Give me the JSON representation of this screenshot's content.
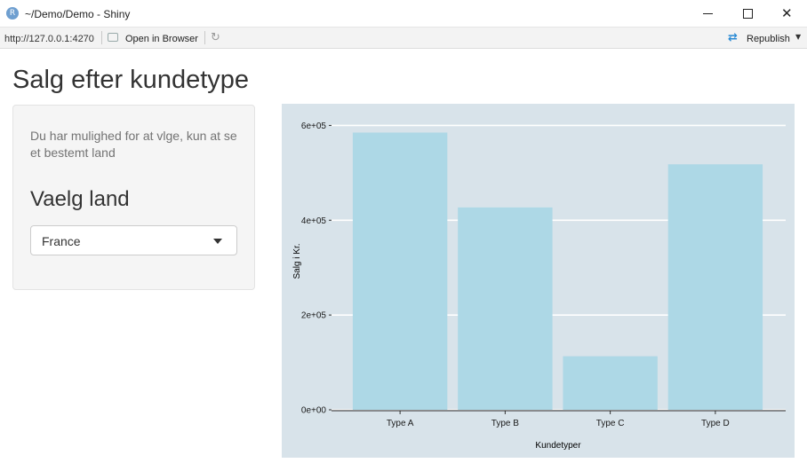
{
  "window": {
    "icon_letter": "R",
    "title": "~/Demo/Demo - Shiny"
  },
  "toolbar": {
    "url": "http://127.0.0.1:4270",
    "open_in_browser": "Open in Browser",
    "republish": "Republish"
  },
  "app": {
    "title": "Salg efter kundetype",
    "help_text": "Du har mulighed for at vlge, kun at se et bestemt land",
    "select_label": "Vaelg land",
    "select_value": "France"
  },
  "chart_data": {
    "type": "bar",
    "categories": [
      "Type A",
      "Type B",
      "Type C",
      "Type D"
    ],
    "values": [
      585000,
      427000,
      113000,
      518000
    ],
    "xlabel": "Kundetyper",
    "ylabel": "Salg i Kr.",
    "ylim": [
      0,
      600000
    ],
    "yticks": [
      0,
      200000,
      400000,
      600000
    ],
    "ytick_labels": [
      "0e+00",
      "2e+05",
      "4e+05",
      "6e+05"
    ],
    "grid": true,
    "colors": {
      "bar": "#add8e6",
      "panel_background": "#d8e3ea",
      "grid": "#ffffff"
    }
  }
}
